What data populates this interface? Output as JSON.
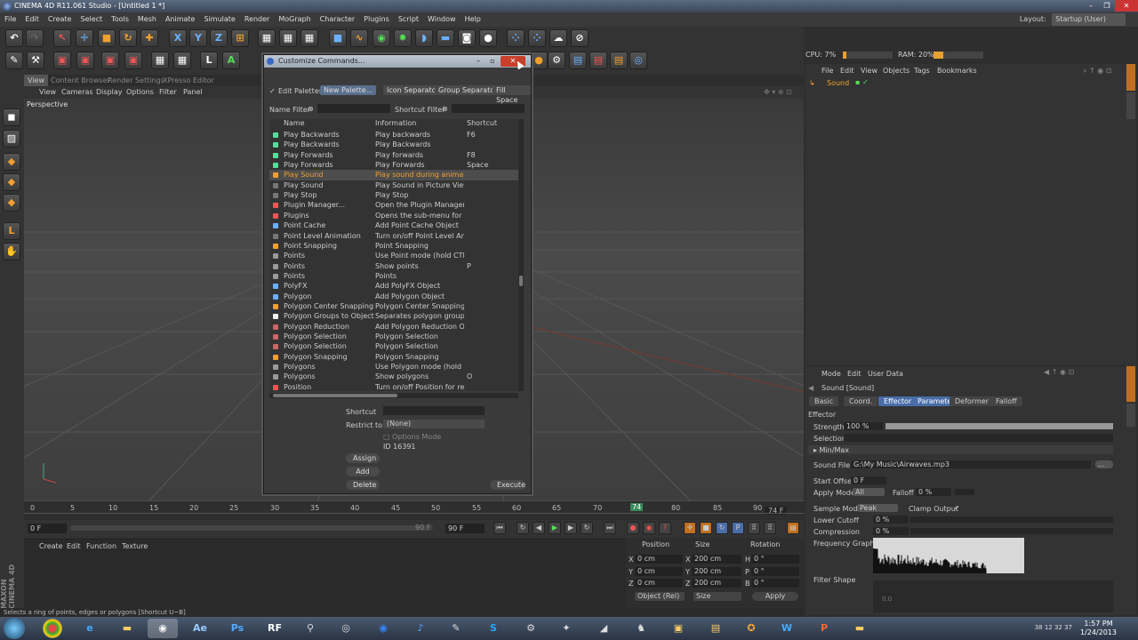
{
  "window": {
    "title": "CINEMA 4D R11.061 Studio - [Untitled 1 *]",
    "controls": [
      "–",
      "❐",
      "✕"
    ]
  },
  "menubar": {
    "items": [
      "File",
      "Edit",
      "Create",
      "Select",
      "Tools",
      "Mesh",
      "Animate",
      "Simulate",
      "Render",
      "MoGraph",
      "Character",
      "Plugins",
      "Script",
      "Window",
      "Help"
    ],
    "layout_label": "Layout:",
    "layout_value": "Startup (User)"
  },
  "toolbar": {
    "axis_x": "X",
    "axis_y": "Y",
    "axis_z": "Z",
    "snap_l": "L",
    "snap_a": "A"
  },
  "viewport": {
    "tabs": [
      "View",
      "Content Browser",
      "Render Settings",
      "XPresso Editor"
    ],
    "menu": [
      "View",
      "Cameras",
      "Display",
      "Options",
      "Filter",
      "Panel"
    ],
    "label": "Perspective"
  },
  "timeline": {
    "ticks": [
      "0",
      "5",
      "10",
      "15",
      "20",
      "25",
      "30",
      "35",
      "40",
      "45",
      "50",
      "55",
      "60",
      "65",
      "70",
      "74",
      "80",
      "85",
      "90"
    ],
    "end_label": "74 F",
    "current_frame": "74",
    "start_field": "0 F",
    "end_field_a": "90 F",
    "end_field_b": "90 F"
  },
  "material": {
    "menu": [
      "Create",
      "Edit",
      "Function",
      "Texture"
    ]
  },
  "coords": {
    "headers": [
      "Position",
      "Size",
      "Rotation"
    ],
    "rows": [
      {
        "axis": "X",
        "pos": "0 cm",
        "saxis": "X",
        "size": "200 cm",
        "raxis": "H",
        "rot": "0 °"
      },
      {
        "axis": "Y",
        "pos": "0 cm",
        "saxis": "Y",
        "size": "200 cm",
        "raxis": "P",
        "rot": "0 °"
      },
      {
        "axis": "Z",
        "pos": "0 cm",
        "saxis": "Z",
        "size": "200 cm",
        "raxis": "B",
        "rot": "0 °"
      }
    ],
    "mode_select": "Object (Rel)",
    "size_select": "Size",
    "apply_label": "Apply"
  },
  "status": "Selects a ring of points, edges or polygons [Shortcut U~B]",
  "perf": {
    "cpu": "CPU: 7%",
    "cpu_pct": 7,
    "ram": "RAM: 20%",
    "ram_pct": 20
  },
  "object_manager": {
    "menu": [
      "File",
      "Edit",
      "View",
      "Objects",
      "Tags",
      "Bookmarks"
    ],
    "object_name": "Sound"
  },
  "attributes": {
    "menu": [
      "Mode",
      "Edit",
      "User Data"
    ],
    "object_title": "Sound [Sound]",
    "tabs": [
      "Basic",
      "Coord.",
      "Effector",
      "Parameter",
      "Deformer",
      "Falloff"
    ],
    "section_effector": "Effector",
    "strength_label": "Strength",
    "strength_value": "100 %",
    "strength_pct": 100,
    "selection_label": "Selection",
    "minmax_label": "▸ Min/Max",
    "sound_file_label": "Sound File",
    "sound_file_value": "G:\\My Music\\Airwaves.mp3",
    "start_offset_label": "Start Offset",
    "start_offset_value": "0 F",
    "apply_mode_label": "Apply Mode",
    "apply_mode_value": "All",
    "falloff_label": "Falloff",
    "falloff_value": "0 %",
    "sample_mode_label": "Sample Mode",
    "sample_mode_value": "Peak",
    "clamp_label": "Clamp Output",
    "clamp_check": "✓",
    "lower_cutoff_label": "Lower Cutoff",
    "lower_cutoff_value": "0 %",
    "compression_label": "Compression",
    "compression_value": "0 %",
    "freq_label": "Frequency Graph",
    "filter_label": "Filter Shape",
    "filter_value": "0.0"
  },
  "dialog": {
    "title": "Customize Commands...",
    "edit_palettes": "Edit Palettes",
    "new_palette": "New Palette...",
    "icon_separator": "Icon Separator",
    "group_separator": "Group Separator",
    "fill_space": "Fill Space",
    "name_filter": "Name Filter",
    "shortcut_filter": "Shortcut Filter",
    "columns": [
      "Name",
      "Information",
      "Shortcut"
    ],
    "rows": [
      {
        "name": "Play Backwards",
        "info": "Play backwards",
        "shortcut": "F6",
        "color": "#5d9"
      },
      {
        "name": "Play Backwards",
        "info": "Play Backwards",
        "shortcut": "",
        "color": "#5d9"
      },
      {
        "name": "Play Forwards",
        "info": "Play forwards",
        "shortcut": "F8",
        "color": "#5d9"
      },
      {
        "name": "Play Forwards",
        "info": "Play Forwards",
        "shortcut": "Space",
        "color": "#5d9"
      },
      {
        "name": "Play Sound",
        "info": "Play sound during animation",
        "shortcut": "",
        "color": "#f0a030",
        "selected": true
      },
      {
        "name": "Play Sound",
        "info": "Play Sound in Picture Viewer",
        "shortcut": "",
        "color": "#777"
      },
      {
        "name": "Play Stop",
        "info": "Play Stop",
        "shortcut": "",
        "color": "#777"
      },
      {
        "name": "Plugin Manager...",
        "info": "Open the Plugin Manager",
        "shortcut": "",
        "color": "#e55"
      },
      {
        "name": "Plugins",
        "info": "Opens the sub-menu for plug",
        "shortcut": "",
        "color": "#e55"
      },
      {
        "name": "Point Cache",
        "info": "Add Point Cache Object",
        "shortcut": "",
        "color": "#6ab0ff"
      },
      {
        "name": "Point Level Animation",
        "info": "Turn on/off Point Level Anima",
        "shortcut": "",
        "color": "#777"
      },
      {
        "name": "Point Snapping",
        "info": "Point Snapping",
        "shortcut": "",
        "color": "#f0a030"
      },
      {
        "name": "Points",
        "info": "Use Point mode (hold CTRL to",
        "shortcut": "",
        "color": "#999"
      },
      {
        "name": "Points",
        "info": "Show points",
        "shortcut": "P",
        "color": "#999"
      },
      {
        "name": "Points",
        "info": "Points",
        "shortcut": "",
        "color": "#999"
      },
      {
        "name": "PolyFX",
        "info": "Add PolyFX Object",
        "shortcut": "",
        "color": "#6ab0ff"
      },
      {
        "name": "Polygon",
        "info": "Add Polygon Object",
        "shortcut": "",
        "color": "#6ab0ff"
      },
      {
        "name": "Polygon Center Snapping",
        "info": "Polygon Center Snapping",
        "shortcut": "",
        "color": "#f0a030"
      },
      {
        "name": "Polygon Groups to Objects",
        "info": "Separates polygon groups in",
        "shortcut": "",
        "color": "#eee"
      },
      {
        "name": "Polygon Reduction",
        "info": "Add Polygon Reduction Obje",
        "shortcut": "",
        "color": "#c66"
      },
      {
        "name": "Polygon Selection",
        "info": "Polygon Selection",
        "shortcut": "",
        "color": "#c66"
      },
      {
        "name": "Polygon Selection",
        "info": "Polygon Selection",
        "shortcut": "",
        "color": "#c66"
      },
      {
        "name": "Polygon Snapping",
        "info": "Polygon Snapping",
        "shortcut": "",
        "color": "#f0a030"
      },
      {
        "name": "Polygons",
        "info": "Use Polygon mode (hold CTRL",
        "shortcut": "",
        "color": "#999"
      },
      {
        "name": "Polygons",
        "info": "Show polygons",
        "shortcut": "O",
        "color": "#999"
      },
      {
        "name": "Position",
        "info": "Turn on/off Position for recor",
        "shortcut": "",
        "color": "#e55"
      }
    ],
    "shortcut_label": "Shortcut",
    "restrict_label": "Restrict to",
    "restrict_value": "(None)",
    "options_mode": "Options Mode",
    "id_label": "ID 16391",
    "assign": "Assign",
    "add": "Add",
    "delete": "Delete",
    "execute": "Execute"
  },
  "taskbar": {
    "time": "1:57 PM",
    "date": "1/24/2013",
    "tray": "38  12  32  37"
  }
}
